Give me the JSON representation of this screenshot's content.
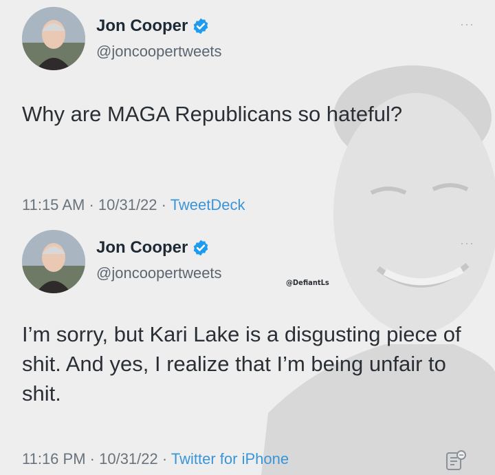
{
  "tweets": [
    {
      "name": "Jon Cooper",
      "handle": "@joncoopertweets",
      "text": "Why are MAGA Republicans so hateful?",
      "time": "11:15 AM",
      "date": "10/31/22",
      "source": "TweetDeck"
    },
    {
      "name": "Jon Cooper",
      "handle": "@joncoopertweets",
      "text": "I’m sorry, but Kari Lake is a disgusting piece of shit. And yes, I realize that I’m being unfair to shit.",
      "time": "11:16 PM",
      "date": "10/31/22",
      "source": "Twitter for iPhone"
    }
  ],
  "watermark": "@DefiantLs",
  "separator": " · ",
  "icons": {
    "verified": "verified-badge-icon",
    "more": "more-options-icon",
    "notes": "notes-icon"
  },
  "colors": {
    "verified": "#1d9bf0",
    "link": "#3a95d8"
  }
}
